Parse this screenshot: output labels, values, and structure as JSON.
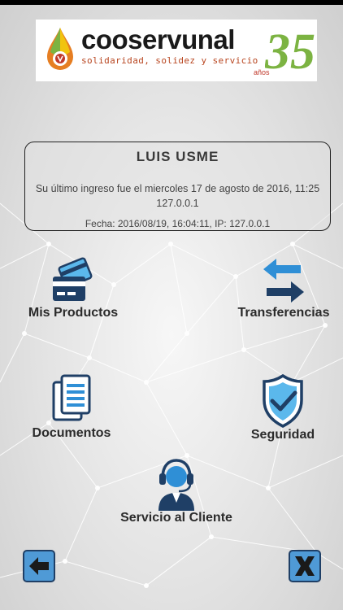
{
  "brand": {
    "name": "cooservunal",
    "tagline": "solidaridad, solidez y servicio",
    "anniversary": "35",
    "anniversary_unit": "años"
  },
  "session": {
    "user_name": "LUIS  USME",
    "last_login": "Su último ingreso fue el miercoles 17 de agosto de 2016, 11:25 127.0.0.1",
    "meta": "Fecha: 2016/08/19, 16:04:11, IP: 127.0.0.1"
  },
  "menu": {
    "mis_productos": "Mis Productos",
    "transferencias": "Transferencias",
    "documentos": "Documentos",
    "seguridad": "Seguridad",
    "servicio_cliente": "Servicio al Cliente"
  },
  "icons": {
    "mis_productos": "cards-icon",
    "transferencias": "transfer-arrows-icon",
    "documentos": "documents-icon",
    "seguridad": "shield-check-icon",
    "servicio_cliente": "headset-agent-icon",
    "back": "arrow-left-icon",
    "close": "close-x-icon"
  },
  "colors": {
    "primary_dark": "#1f3f66",
    "primary": "#2f8fd6",
    "card_blue": "#5bb8ec",
    "accent_red": "#c0392b",
    "accent_orange": "#e67e22",
    "accent_green": "#7cb342"
  }
}
